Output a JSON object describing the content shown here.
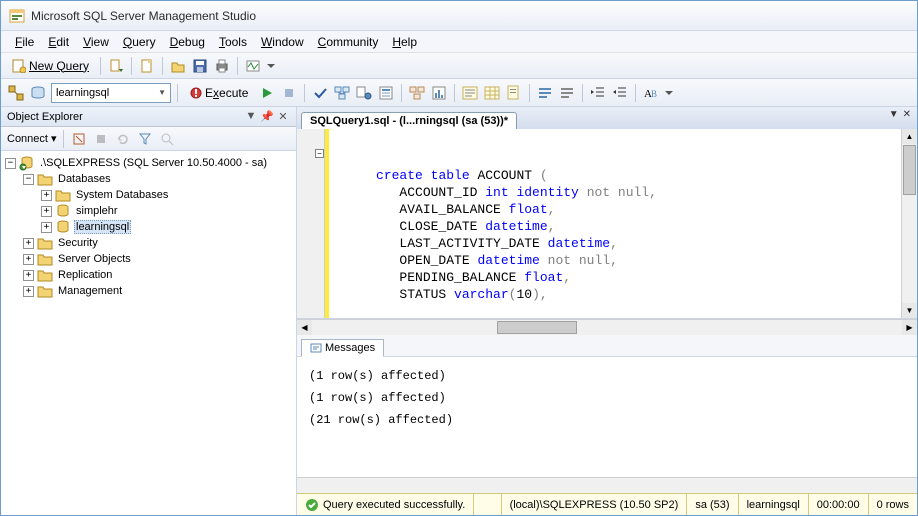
{
  "window": {
    "title": "Microsoft SQL Server Management Studio"
  },
  "menu": {
    "file": "File",
    "edit": "Edit",
    "view": "View",
    "query": "Query",
    "debug": "Debug",
    "tools": "Tools",
    "window": "Window",
    "community": "Community",
    "help": "Help"
  },
  "toolbar": {
    "new_query": "New Query"
  },
  "toolbar2": {
    "database": "learningsql",
    "execute": "Execute"
  },
  "explorer": {
    "title": "Object Explorer",
    "connect": "Connect",
    "root": ".\\SQLEXPRESS (SQL Server 10.50.4000 - sa)",
    "databases": "Databases",
    "sysdb": "System Databases",
    "db1": "simplehr",
    "db2": "learningsql",
    "security": "Security",
    "serverobj": "Server Objects",
    "replication": "Replication",
    "management": "Management"
  },
  "tab": {
    "title": "SQLQuery1.sql - (l...rningsql (sa (53))*"
  },
  "code": {
    "l1": "create table ACCOUNT (",
    "l2": "   ACCOUNT_ID int identity not null,",
    "l3": "   AVAIL_BALANCE float,",
    "l4": "   CLOSE_DATE datetime,",
    "l5": "   LAST_ACTIVITY_DATE datetime,",
    "l6": "   OPEN_DATE datetime not null,",
    "l7": "   PENDING_BALANCE float,",
    "l8": "   STATUS varchar(10),"
  },
  "messages": {
    "tab": "Messages",
    "m1": "(1 row(s) affected)",
    "m2": "(1 row(s) affected)",
    "m3": "(21 row(s) affected)"
  },
  "status": {
    "ok": "Query executed successfully.",
    "server": "(local)\\SQLEXPRESS (10.50 SP2)",
    "user": "sa (53)",
    "db": "learningsql",
    "time": "00:00:00",
    "rows": "0 rows"
  }
}
